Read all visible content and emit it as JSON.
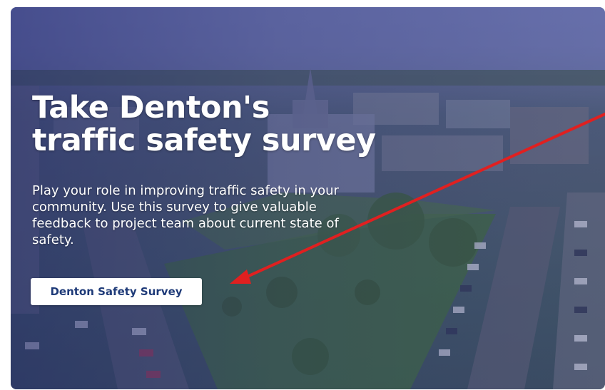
{
  "hero": {
    "title_line1": "Take Denton's",
    "title_line2": "traffic safety survey",
    "description": "Play your role in improving traffic safety in your community. Use this survey to give valuable feedback to project team about current state of safety.",
    "cta_label": "Denton Safety Survey",
    "background_image": "aerial-view-denton-courthouse-square"
  },
  "annotation": {
    "type": "arrow",
    "color": "#e02020"
  },
  "colors": {
    "overlay": "#2a2f78",
    "cta_background": "#ffffff",
    "cta_text": "#1e3a78",
    "heading_text": "#ffffff"
  }
}
